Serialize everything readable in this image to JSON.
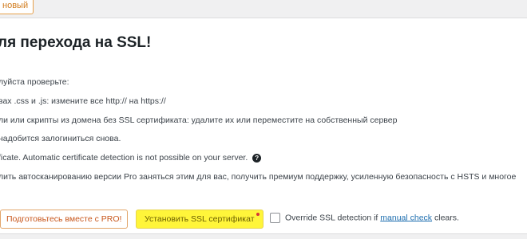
{
  "header": {
    "new_button_label": "новый"
  },
  "main": {
    "title": "ля перехода на SSL!",
    "lines": [
      "луйста проверьте:",
      "вах .css и .js: измените все http:// на https://",
      "ли или скрипты из домена без SSL сертификата: удалите их или переместите на собственный сервер",
      "надобится залогиниться снова.",
      "ficate. Automatic certificate detection is not possible on your server.",
      "лить автосканированию версии Pro заняться этим для вас, получить премиум поддержку, усиленную безопасность с HSTS и многое"
    ],
    "help_icon_glyph": "?"
  },
  "actions": {
    "pro_button_label": "Подготовьтесь вместе с PRO!",
    "activate_ssl_label": "Установить SSL сертификат",
    "override_text_before": "Override SSL detection if ",
    "override_link_text": "manual check",
    "override_text_after": " clears."
  }
}
